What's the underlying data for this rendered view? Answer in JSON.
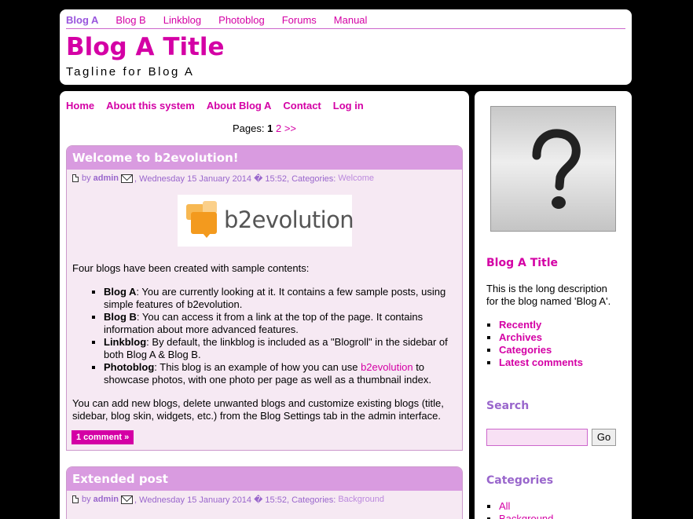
{
  "blog_tabs": [
    "Blog A",
    "Blog B",
    "Linkblog",
    "Photoblog",
    "Forums",
    "Manual"
  ],
  "header": {
    "title": "Blog A Title",
    "tagline": "Tagline for Blog A"
  },
  "menu": [
    "Home",
    "About this system",
    "About Blog A",
    "Contact",
    "Log in"
  ],
  "pagination": {
    "label": "Pages:",
    "current": "1",
    "next_page": "2",
    "next": ">>"
  },
  "posts": [
    {
      "title": "Welcome to b2evolution!",
      "by": "by",
      "author": "admin",
      "date": ", Wednesday 15 January 2014 � 15:52, Categories:",
      "category": "Welcome",
      "logo_text": "b2evolution",
      "intro": "Four blogs have been created with sample contents:",
      "list": [
        {
          "name": "Blog A",
          "text": ": You are currently looking at it. It contains a few sample posts, using simple features of b2evolution."
        },
        {
          "name": "Blog B",
          "text": ": You can access it from a link at the top of the page. It contains information about more advanced features."
        },
        {
          "name": "Linkblog",
          "text": ": By default, the linkblog is included as a \"Blogroll\" in the sidebar of both Blog A & Blog B."
        },
        {
          "name": "Photoblog",
          "text_before": ": This blog is an example of how you can use ",
          "link": "b2evolution",
          "text_after": " to showcase photos, with one photo per page as well as a thumbnail index."
        }
      ],
      "outro": "You can add new blogs, delete unwanted blogs and customize existing blogs (title, sidebar, blog skin, widgets, etc.) from the Blog Settings tab in the admin interface.",
      "comment_button": "1 comment »"
    },
    {
      "title": "Extended post",
      "by": "by",
      "author": "admin",
      "date": ", Wednesday 15 January 2014 � 15:52, Categories:",
      "category": "Background"
    }
  ],
  "sidebar": {
    "avatar_icon": "question-mark-icon",
    "blog_title": "Blog A Title",
    "description": "This is the long description for the blog named 'Blog A'.",
    "links": [
      "Recently",
      "Archives",
      "Categories",
      "Latest comments"
    ],
    "search_title": "Search",
    "search_value": "",
    "search_button": "Go",
    "categories_title": "Categories",
    "categories": [
      "All",
      "Background"
    ]
  },
  "colors": {
    "accent": "#d400a5",
    "secondary": "#9966cc",
    "post_header": "#d99be0",
    "post_bg": "#f6e9f3"
  }
}
